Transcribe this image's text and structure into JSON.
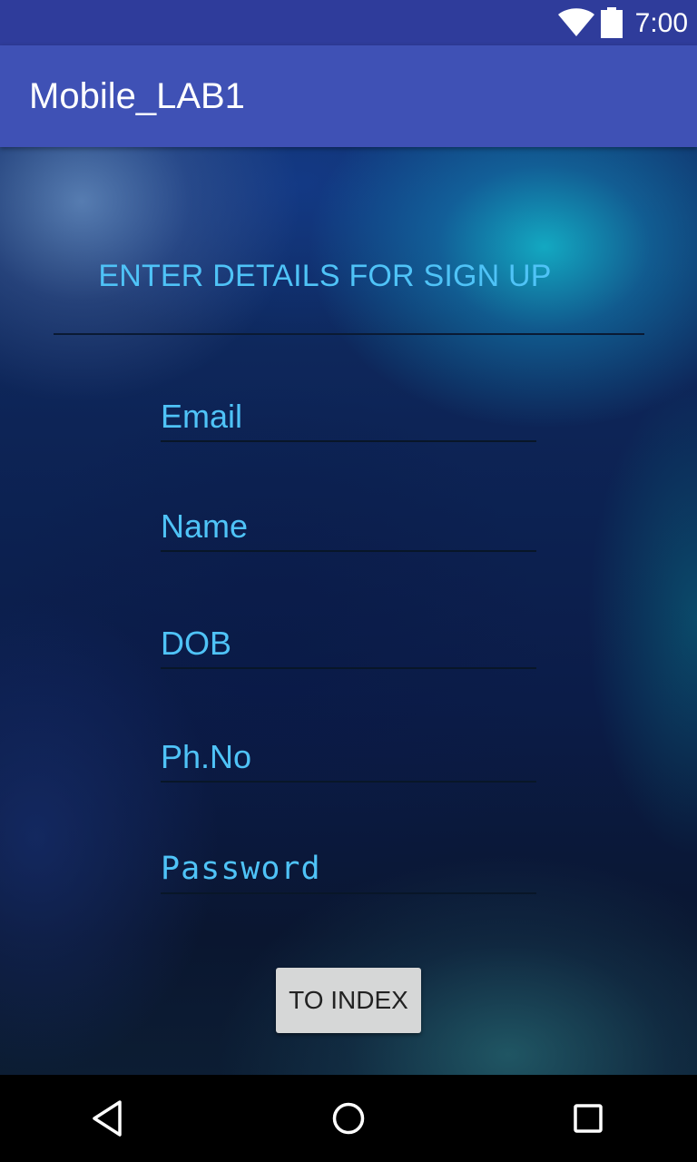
{
  "status_bar": {
    "time": "7:00",
    "icons": [
      "wifi-icon",
      "battery-icon"
    ]
  },
  "app_bar": {
    "title": "Mobile_LAB1"
  },
  "form": {
    "heading": "ENTER DETAILS FOR SIGN UP",
    "fields": [
      {
        "id": "email",
        "placeholder": "Email",
        "value": ""
      },
      {
        "id": "name",
        "placeholder": "Name",
        "value": ""
      },
      {
        "id": "dob",
        "placeholder": "DOB",
        "value": ""
      },
      {
        "id": "phone",
        "placeholder": "Ph.No",
        "value": ""
      },
      {
        "id": "password",
        "placeholder": "Password",
        "value": ""
      }
    ],
    "button_label": "TO INDEX"
  },
  "nav_bar": {
    "icons": [
      "back-icon",
      "home-icon",
      "recents-icon"
    ]
  },
  "colors": {
    "status_bar": "#2f3c9b",
    "app_bar": "#3f51b5",
    "accent_text": "#4fc3f7",
    "button": "#d6d7d7"
  }
}
